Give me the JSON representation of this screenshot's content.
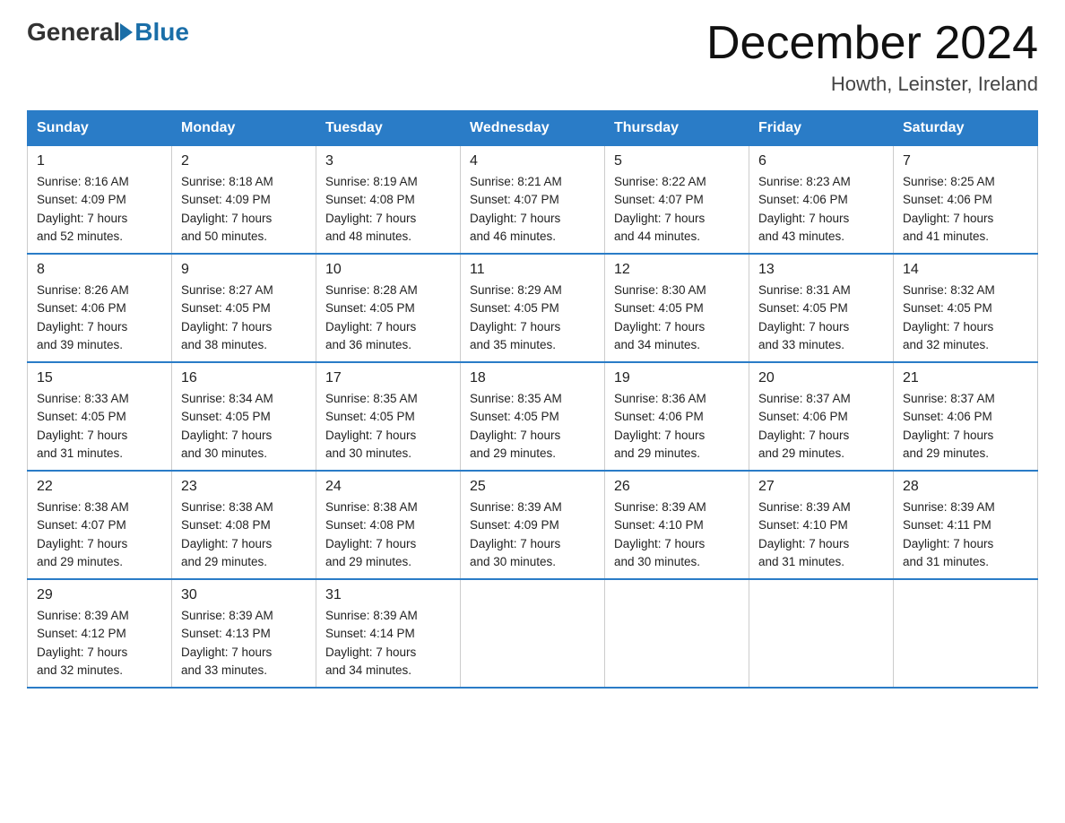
{
  "header": {
    "logo_general": "General",
    "logo_blue": "Blue",
    "month_title": "December 2024",
    "location": "Howth, Leinster, Ireland"
  },
  "days_of_week": [
    "Sunday",
    "Monday",
    "Tuesday",
    "Wednesday",
    "Thursday",
    "Friday",
    "Saturday"
  ],
  "weeks": [
    [
      {
        "day": "1",
        "sunrise": "8:16 AM",
        "sunset": "4:09 PM",
        "daylight": "7 hours and 52 minutes."
      },
      {
        "day": "2",
        "sunrise": "8:18 AM",
        "sunset": "4:09 PM",
        "daylight": "7 hours and 50 minutes."
      },
      {
        "day": "3",
        "sunrise": "8:19 AM",
        "sunset": "4:08 PM",
        "daylight": "7 hours and 48 minutes."
      },
      {
        "day": "4",
        "sunrise": "8:21 AM",
        "sunset": "4:07 PM",
        "daylight": "7 hours and 46 minutes."
      },
      {
        "day": "5",
        "sunrise": "8:22 AM",
        "sunset": "4:07 PM",
        "daylight": "7 hours and 44 minutes."
      },
      {
        "day": "6",
        "sunrise": "8:23 AM",
        "sunset": "4:06 PM",
        "daylight": "7 hours and 43 minutes."
      },
      {
        "day": "7",
        "sunrise": "8:25 AM",
        "sunset": "4:06 PM",
        "daylight": "7 hours and 41 minutes."
      }
    ],
    [
      {
        "day": "8",
        "sunrise": "8:26 AM",
        "sunset": "4:06 PM",
        "daylight": "7 hours and 39 minutes."
      },
      {
        "day": "9",
        "sunrise": "8:27 AM",
        "sunset": "4:05 PM",
        "daylight": "7 hours and 38 minutes."
      },
      {
        "day": "10",
        "sunrise": "8:28 AM",
        "sunset": "4:05 PM",
        "daylight": "7 hours and 36 minutes."
      },
      {
        "day": "11",
        "sunrise": "8:29 AM",
        "sunset": "4:05 PM",
        "daylight": "7 hours and 35 minutes."
      },
      {
        "day": "12",
        "sunrise": "8:30 AM",
        "sunset": "4:05 PM",
        "daylight": "7 hours and 34 minutes."
      },
      {
        "day": "13",
        "sunrise": "8:31 AM",
        "sunset": "4:05 PM",
        "daylight": "7 hours and 33 minutes."
      },
      {
        "day": "14",
        "sunrise": "8:32 AM",
        "sunset": "4:05 PM",
        "daylight": "7 hours and 32 minutes."
      }
    ],
    [
      {
        "day": "15",
        "sunrise": "8:33 AM",
        "sunset": "4:05 PM",
        "daylight": "7 hours and 31 minutes."
      },
      {
        "day": "16",
        "sunrise": "8:34 AM",
        "sunset": "4:05 PM",
        "daylight": "7 hours and 30 minutes."
      },
      {
        "day": "17",
        "sunrise": "8:35 AM",
        "sunset": "4:05 PM",
        "daylight": "7 hours and 30 minutes."
      },
      {
        "day": "18",
        "sunrise": "8:35 AM",
        "sunset": "4:05 PM",
        "daylight": "7 hours and 29 minutes."
      },
      {
        "day": "19",
        "sunrise": "8:36 AM",
        "sunset": "4:06 PM",
        "daylight": "7 hours and 29 minutes."
      },
      {
        "day": "20",
        "sunrise": "8:37 AM",
        "sunset": "4:06 PM",
        "daylight": "7 hours and 29 minutes."
      },
      {
        "day": "21",
        "sunrise": "8:37 AM",
        "sunset": "4:06 PM",
        "daylight": "7 hours and 29 minutes."
      }
    ],
    [
      {
        "day": "22",
        "sunrise": "8:38 AM",
        "sunset": "4:07 PM",
        "daylight": "7 hours and 29 minutes."
      },
      {
        "day": "23",
        "sunrise": "8:38 AM",
        "sunset": "4:08 PM",
        "daylight": "7 hours and 29 minutes."
      },
      {
        "day": "24",
        "sunrise": "8:38 AM",
        "sunset": "4:08 PM",
        "daylight": "7 hours and 29 minutes."
      },
      {
        "day": "25",
        "sunrise": "8:39 AM",
        "sunset": "4:09 PM",
        "daylight": "7 hours and 30 minutes."
      },
      {
        "day": "26",
        "sunrise": "8:39 AM",
        "sunset": "4:10 PM",
        "daylight": "7 hours and 30 minutes."
      },
      {
        "day": "27",
        "sunrise": "8:39 AM",
        "sunset": "4:10 PM",
        "daylight": "7 hours and 31 minutes."
      },
      {
        "day": "28",
        "sunrise": "8:39 AM",
        "sunset": "4:11 PM",
        "daylight": "7 hours and 31 minutes."
      }
    ],
    [
      {
        "day": "29",
        "sunrise": "8:39 AM",
        "sunset": "4:12 PM",
        "daylight": "7 hours and 32 minutes."
      },
      {
        "day": "30",
        "sunrise": "8:39 AM",
        "sunset": "4:13 PM",
        "daylight": "7 hours and 33 minutes."
      },
      {
        "day": "31",
        "sunrise": "8:39 AM",
        "sunset": "4:14 PM",
        "daylight": "7 hours and 34 minutes."
      },
      null,
      null,
      null,
      null
    ]
  ],
  "labels": {
    "sunrise": "Sunrise:",
    "sunset": "Sunset:",
    "daylight": "Daylight:"
  }
}
